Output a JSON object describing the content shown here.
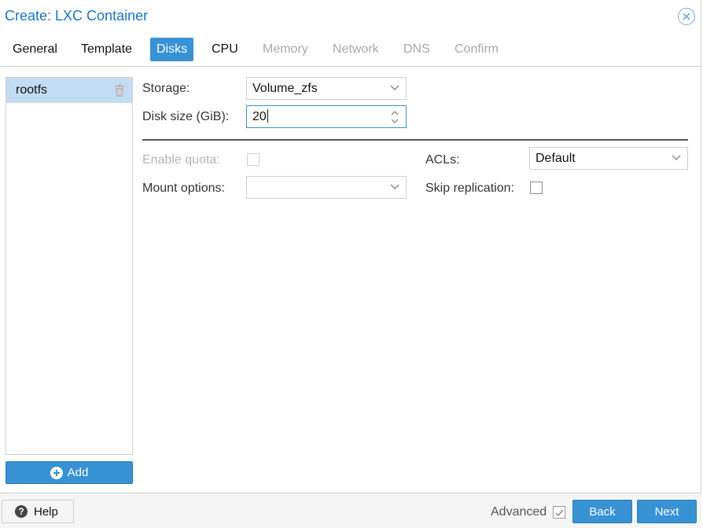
{
  "window": {
    "title": "Create: LXC Container"
  },
  "tabs": [
    {
      "label": "General",
      "state": "enabled"
    },
    {
      "label": "Template",
      "state": "enabled"
    },
    {
      "label": "Disks",
      "state": "active"
    },
    {
      "label": "CPU",
      "state": "enabled"
    },
    {
      "label": "Memory",
      "state": "disabled"
    },
    {
      "label": "Network",
      "state": "disabled"
    },
    {
      "label": "DNS",
      "state": "disabled"
    },
    {
      "label": "Confirm",
      "state": "disabled"
    }
  ],
  "disks": {
    "items": [
      {
        "label": "rootfs",
        "selected": true
      }
    ],
    "add_label": "Add"
  },
  "form": {
    "storage_label": "Storage:",
    "storage_value": "Volume_zfs",
    "disk_size_label": "Disk size (GiB):",
    "disk_size_value": "20",
    "enable_quota_label": "Enable quota:",
    "enable_quota_checked": false,
    "acls_label": "ACLs:",
    "acls_value": "Default",
    "mount_options_label": "Mount options:",
    "mount_options_value": "",
    "skip_replication_label": "Skip replication:",
    "skip_replication_checked": false
  },
  "footer": {
    "help_label": "Help",
    "advanced_label": "Advanced",
    "advanced_checked": true,
    "back_label": "Back",
    "next_label": "Next"
  },
  "colors": {
    "accent": "#3892d4",
    "title": "#1a74c4",
    "selected_row": "#c2dcf3",
    "disabled_text": "#a8a8a8"
  },
  "icons": {
    "close": "close-circle-icon",
    "trash": "trash-icon",
    "add": "plus-circle-icon",
    "help": "question-circle-icon",
    "dropdown": "chevron-down-icon",
    "spinner": "spinner-arrows-icon",
    "check": "checkmark-icon"
  }
}
